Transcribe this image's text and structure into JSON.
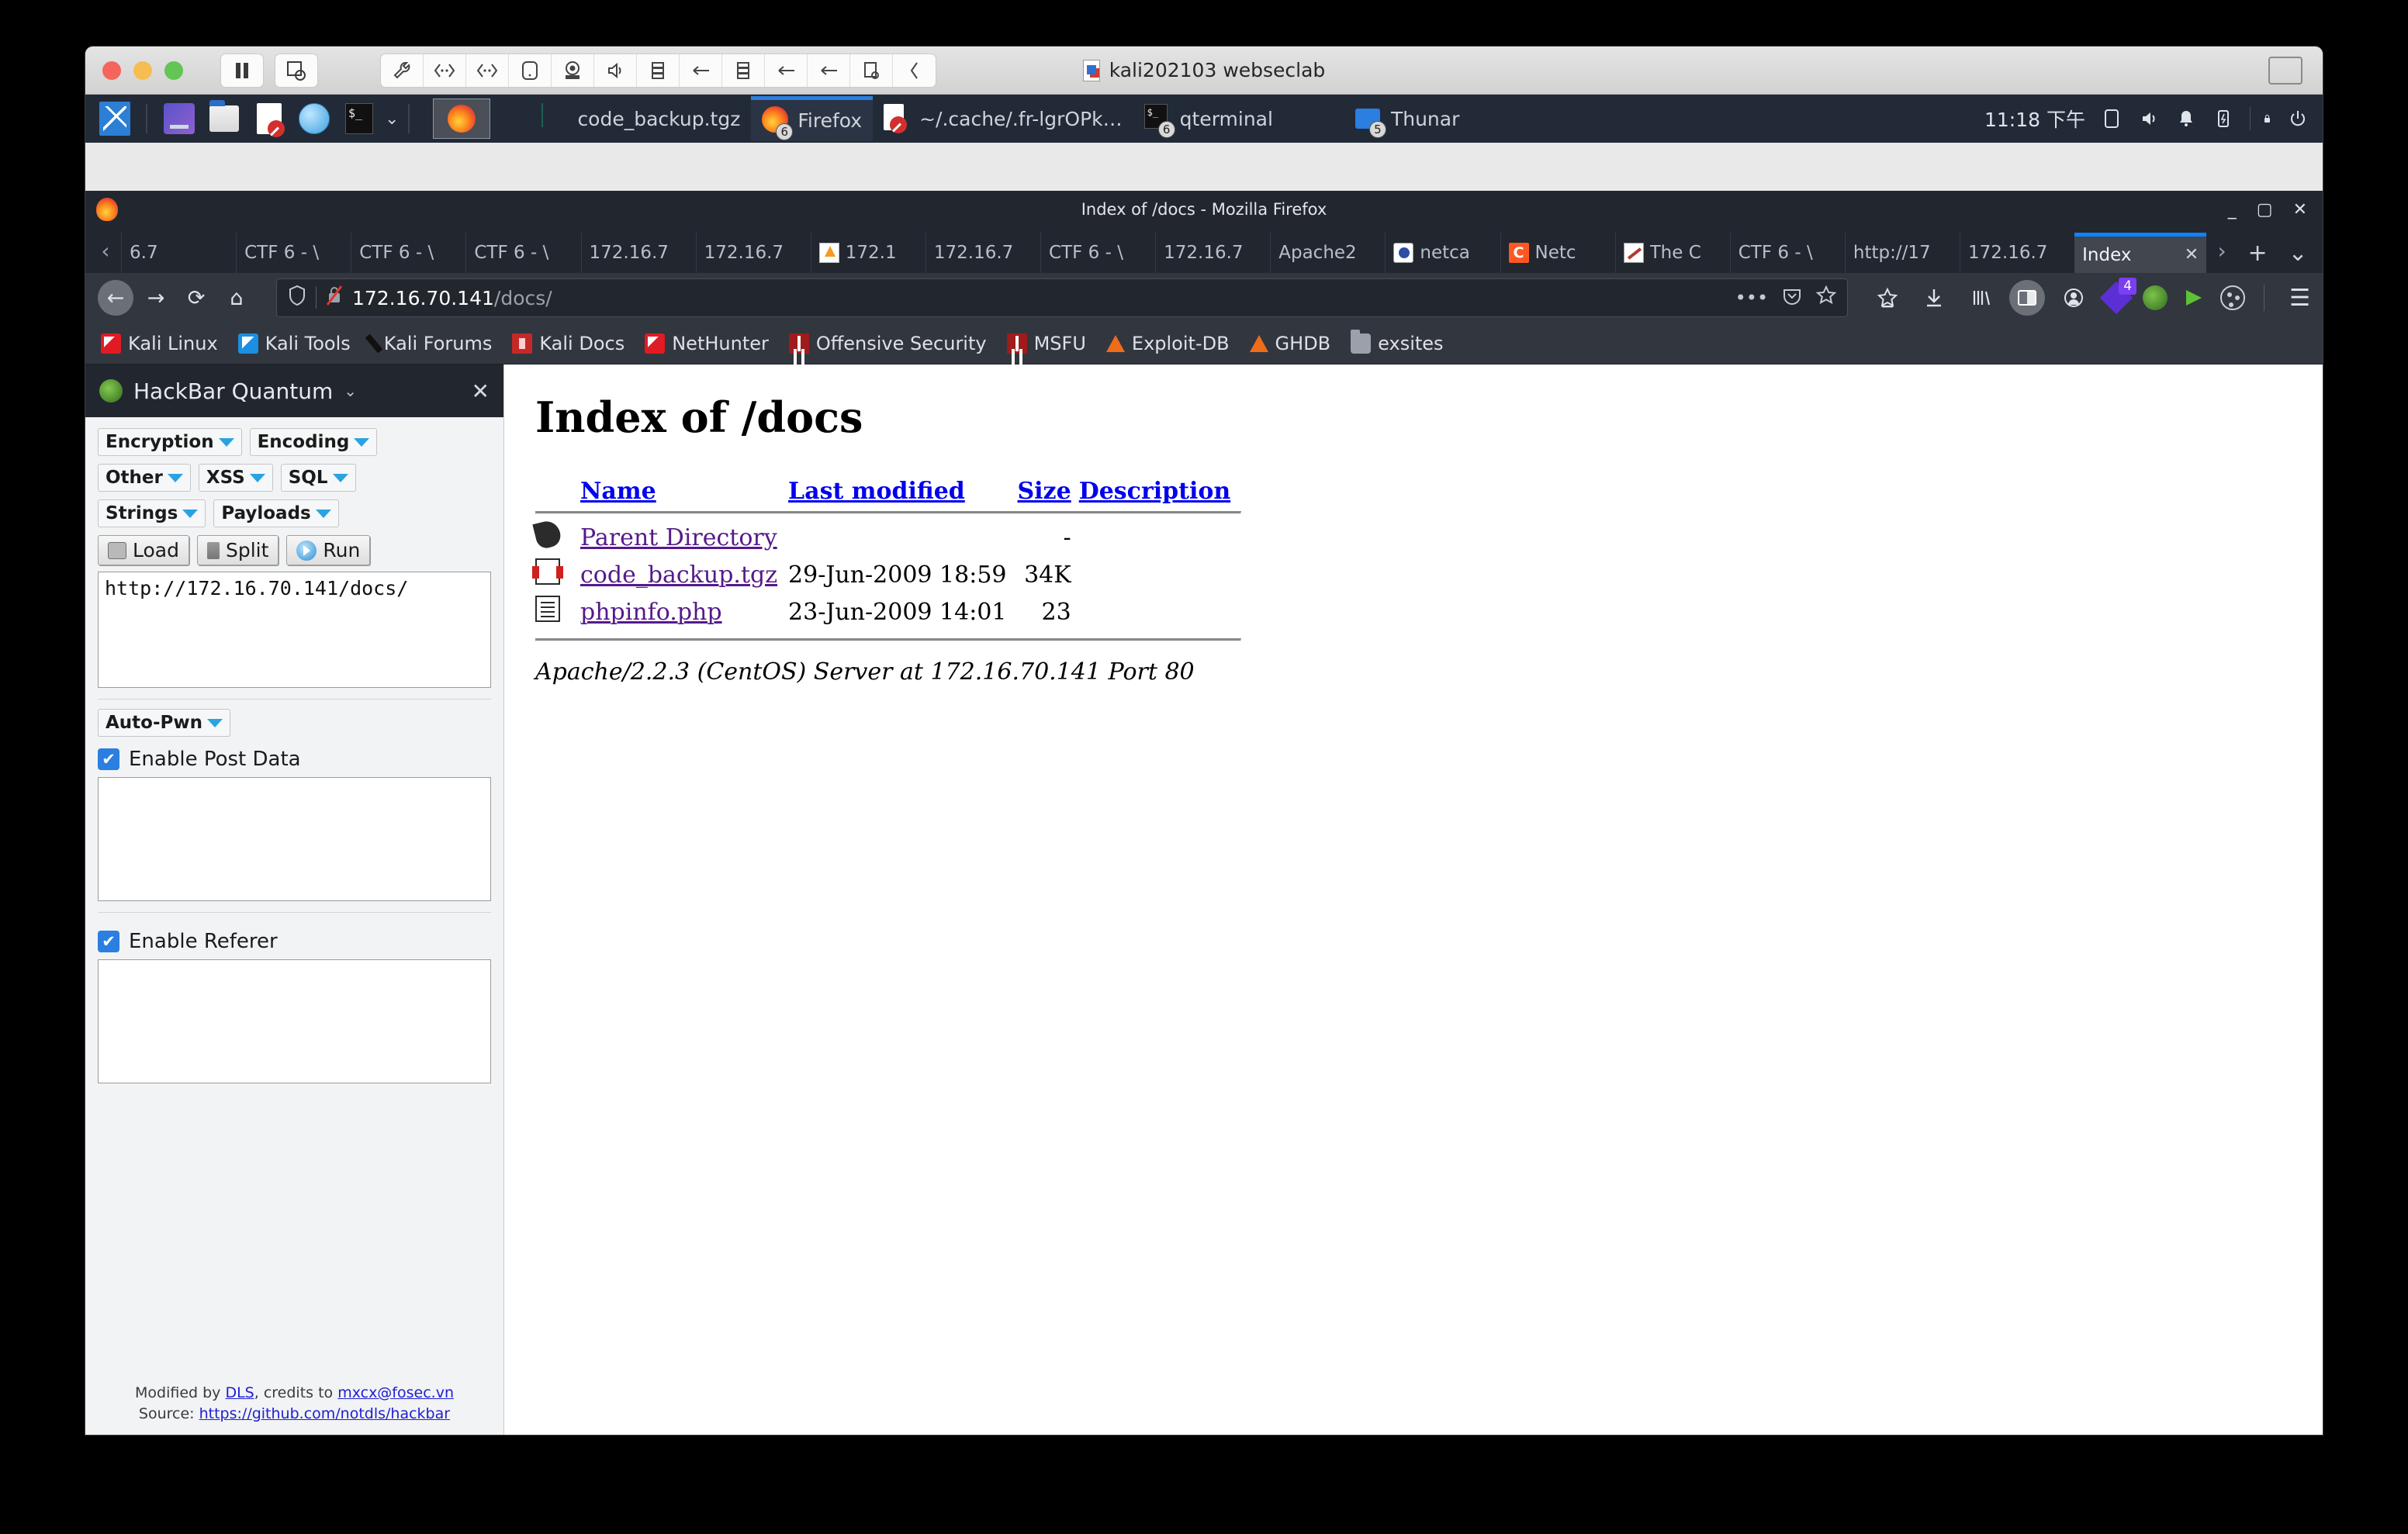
{
  "vm": {
    "title": "kali202103 webseclab",
    "toolbar_icons": [
      "wrench-icon",
      "network-icon",
      "network-icon-2",
      "harddisk-icon",
      "camera-icon",
      "speaker-icon",
      "usb-stack-icon",
      "usb-icon",
      "usb-stack-icon-2",
      "usb-icon-2",
      "usb-icon-3",
      "printer-icon",
      "collapse-icon"
    ],
    "pause_label": "⏸",
    "snapshot_label": "snapshot"
  },
  "taskbar": {
    "launchers": [
      "kali-menu",
      "terminal",
      "file-manager",
      "text-editor",
      "web-browser",
      "terminal-dropdown"
    ],
    "items": [
      {
        "label": "code_backup.tgz",
        "icon": "archive-icon",
        "badge": "",
        "active": false
      },
      {
        "label": "Firefox",
        "icon": "firefox-icon",
        "badge": "6",
        "active": true
      },
      {
        "label": "~/.cache/.fr-lgrOPk…",
        "icon": "archive-doc-icon",
        "badge": "",
        "active": false
      },
      {
        "label": "qterminal",
        "icon": "terminal-icon",
        "badge": "6",
        "active": false
      },
      {
        "label": "Thunar",
        "icon": "folder-icon",
        "badge": "5",
        "active": false
      }
    ],
    "clock": "11:18 下午",
    "tray_icons": [
      "display-icon",
      "volume-icon",
      "notification-icon",
      "battery-icon",
      "lock-icon",
      "logout-icon"
    ]
  },
  "firefox": {
    "window_title": "Index of /docs - Mozilla Firefox",
    "window_controls": [
      "minimize",
      "maximize",
      "close"
    ],
    "tabs": [
      {
        "label": "6.7",
        "favicon": "generic"
      },
      {
        "label": "CTF 6 - \\",
        "favicon": "none"
      },
      {
        "label": "CTF 6 - \\",
        "favicon": "none"
      },
      {
        "label": "CTF 6 - \\",
        "favicon": "none"
      },
      {
        "label": "172.16.7",
        "favicon": "none"
      },
      {
        "label": "172.16.7",
        "favicon": "none"
      },
      {
        "label": "172.1",
        "favicon": "pma"
      },
      {
        "label": "172.16.7",
        "favicon": "none"
      },
      {
        "label": "CTF 6 - \\",
        "favicon": "none"
      },
      {
        "label": "172.16.7",
        "favicon": "none"
      },
      {
        "label": "Apache2",
        "favicon": "apache"
      },
      {
        "label": "netca",
        "favicon": "paw"
      },
      {
        "label": "Netc",
        "favicon": "c-orange"
      },
      {
        "label": "The C",
        "favicon": "knife"
      },
      {
        "label": "CTF 6 - \\",
        "favicon": "none"
      },
      {
        "label": "http://17",
        "favicon": "none"
      },
      {
        "label": "172.16.7",
        "favicon": "none"
      },
      {
        "label": "Index",
        "favicon": "none",
        "selected": true,
        "close": "✕"
      }
    ],
    "tab_new_label": "+",
    "tab_list_label": "⌄",
    "tab_scroll_left": "‹",
    "tab_scroll_right": "›",
    "nav": {
      "back": "←",
      "forward": "→",
      "reload": "⟳",
      "home": "⌂"
    },
    "urlbar": {
      "shield_icon": "shield-icon",
      "security_icon": "insecure-connection-icon",
      "host": "172.16.70.141",
      "path": "/docs/",
      "ellipsis": "•••",
      "pocket_icon": "pocket-icon",
      "bookmark_icon": "star-icon"
    },
    "toolbar_right": {
      "save_to_pocket": "☆",
      "downloads": "⤓",
      "library": "|||",
      "sidebars": "sidebar-icon",
      "account": "account-icon",
      "ext_layers_badge": "4",
      "ext_hackbar": "hackbar-icon",
      "ext_wappalyzer": "wappalyzer-icon",
      "ext_cookie": "cookie-icon",
      "menu": "☰"
    },
    "bookmarks": [
      {
        "label": "Kali Linux",
        "icon": "kali-icon"
      },
      {
        "label": "Kali Tools",
        "icon": "kali-tools-icon"
      },
      {
        "label": "Kali Forums",
        "icon": "kali-forums-icon"
      },
      {
        "label": "Kali Docs",
        "icon": "kali-docs-icon"
      },
      {
        "label": "NetHunter",
        "icon": "nethunter-icon"
      },
      {
        "label": "Offensive Security",
        "icon": "offsec-icon"
      },
      {
        "label": "MSFU",
        "icon": "msfu-icon"
      },
      {
        "label": "Exploit-DB",
        "icon": "exploitdb-icon"
      },
      {
        "label": "GHDB",
        "icon": "ghdb-icon"
      },
      {
        "label": "exsites",
        "icon": "folder-icon"
      }
    ]
  },
  "sidebar": {
    "title": "HackBar Quantum",
    "caret": "⌄",
    "close": "✕",
    "buttons_row1": [
      {
        "label": "Encryption"
      },
      {
        "label": "Encoding"
      }
    ],
    "buttons_row2": [
      {
        "label": "Other"
      },
      {
        "label": "XSS"
      },
      {
        "label": "SQL"
      }
    ],
    "buttons_row3": [
      {
        "label": "Strings"
      },
      {
        "label": "Payloads"
      }
    ],
    "actions": [
      {
        "label": "Load",
        "icon": "load-icon"
      },
      {
        "label": "Split",
        "icon": "split-icon"
      },
      {
        "label": "Run",
        "icon": "run-icon"
      }
    ],
    "url_value": "http://172.16.70.141/docs/",
    "autopwn_label": "Auto-Pwn",
    "post_checkbox_label": "Enable Post Data",
    "post_checked": true,
    "post_value": "",
    "referer_checkbox_label": "Enable Referer",
    "referer_checked": true,
    "referer_value": "",
    "footer": {
      "line1_prefix": "Modified by ",
      "line1_link1": "DLS",
      "line1_mid": ", credits to ",
      "line1_link2": "mxcx@fosec.vn",
      "line2_prefix": "Source: ",
      "line2_link": "https://github.com/notdls/hackbar"
    }
  },
  "page": {
    "heading": "Index of /docs",
    "columns": [
      "Name",
      "Last modified",
      "Size",
      "Description"
    ],
    "rows": [
      {
        "icon": "parent-directory-icon",
        "name": "Parent Directory",
        "modified": "",
        "size": "-",
        "description": ""
      },
      {
        "icon": "compressed-file-icon",
        "name": "code_backup.tgz",
        "modified": "29-Jun-2009 18:59",
        "size": "34K",
        "description": ""
      },
      {
        "icon": "text-file-icon",
        "name": "phpinfo.php",
        "modified": "23-Jun-2009 14:01",
        "size": "23",
        "description": ""
      }
    ],
    "server_signature": "Apache/2.2.3 (CentOS) Server at 172.16.70.141 Port 80"
  },
  "colors": {
    "accent": "#0a84ff",
    "taskbar_bg": "#222a38",
    "firefox_chrome": "#32363e",
    "link": "#0000ee",
    "visited_link": "#551a8b"
  }
}
